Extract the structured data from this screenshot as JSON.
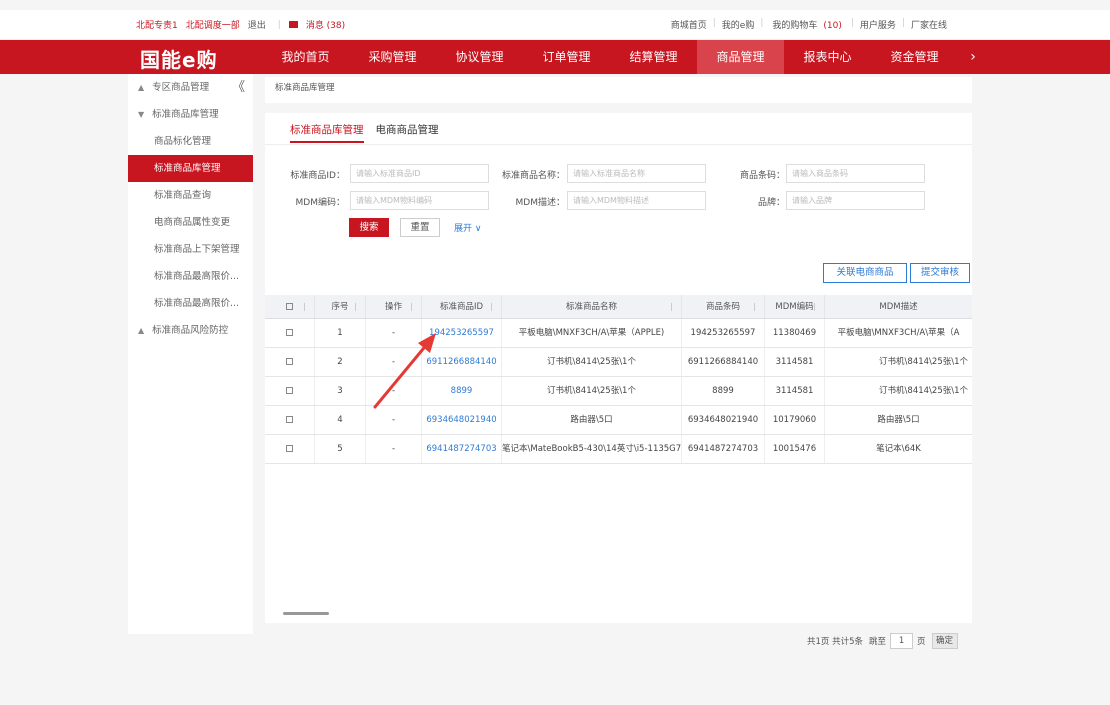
{
  "topbar": {
    "user_role": "北配专责1",
    "dept": "北配调度一部",
    "logout": "退出",
    "messages": "消息 (38)",
    "links": [
      "商城首页",
      "我的e购",
      "我的购物车",
      "用户服务",
      "厂家在线"
    ],
    "cart_count": "(10)"
  },
  "nav": {
    "logo": "国能e购",
    "items": [
      "我的首页",
      "采购管理",
      "协议管理",
      "订单管理",
      "结算管理",
      "商品管理",
      "报表中心",
      "资金管理"
    ],
    "more": "›"
  },
  "sidebar": {
    "items": [
      "专区商品管理",
      "标准商品库管理",
      "商品标化管理",
      "标准商品库管理",
      "标准商品查询",
      "电商商品属性变更",
      "标准商品上下架管理",
      "标准商品最高限价...",
      "标准商品最高限价...",
      "标准商品风险防控"
    ],
    "collapse": "《"
  },
  "breadcrumb": "标准商品库管理",
  "tabs": [
    "标准商品库管理",
    "电商商品管理"
  ],
  "form": {
    "labels": [
      "标准商品ID：",
      "标准商品名称：",
      "商品条码：",
      "MDM编码：",
      "MDM描述：",
      "品牌："
    ],
    "placeholders": [
      "请输入标准商品ID",
      "请输入标准商品名称",
      "请输入商品条码",
      "请输入MDM物料编码",
      "请输入MDM物料描述",
      "请输入品牌"
    ],
    "search": "搜索",
    "reset": "重置",
    "expand": "展开 ∨"
  },
  "actions": {
    "link_ecommerce": "关联电商商品",
    "submit_review": "提交审核"
  },
  "table": {
    "headers": [
      "",
      "序号",
      "操作",
      "标准商品ID",
      "标准商品名称",
      "商品条码",
      "MDM编码",
      "MDM描述"
    ],
    "rows": [
      {
        "no": "1",
        "op": "-",
        "id": "194253265597",
        "name": "平板电脑\\MNXF3CH/A\\苹果（APPLE)",
        "barcode": "194253265597",
        "mdm": "11380469",
        "desc": "平板电脑\\MNXF3CH/A\\苹果（A"
      },
      {
        "no": "2",
        "op": "-",
        "id": "6911266884140",
        "name": "订书机\\8414\\25张\\1个",
        "barcode": "6911266884140",
        "mdm": "3114581",
        "desc": "订书机\\8414\\25张\\1个"
      },
      {
        "no": "3",
        "op": "-",
        "id": "8899",
        "name": "订书机\\8414\\25张\\1个",
        "barcode": "8899",
        "mdm": "3114581",
        "desc": "订书机\\8414\\25张\\1个"
      },
      {
        "no": "4",
        "op": "-",
        "id": "6934648021940",
        "name": "路由器\\5口",
        "barcode": "6934648021940",
        "mdm": "10179060",
        "desc": "路由器\\5口"
      },
      {
        "no": "5",
        "op": "-",
        "id": "6941487274703",
        "name": "笔记本\\MateBookB5-430\\14英寸\\i5-1135G7",
        "barcode": "6941487274703",
        "mdm": "10015476",
        "desc": "笔记本\\64K"
      }
    ]
  },
  "pagination": {
    "summary": "共1页 共计5条",
    "jump": "跳至",
    "page": "1",
    "unit": "页",
    "confirm": "确定"
  }
}
